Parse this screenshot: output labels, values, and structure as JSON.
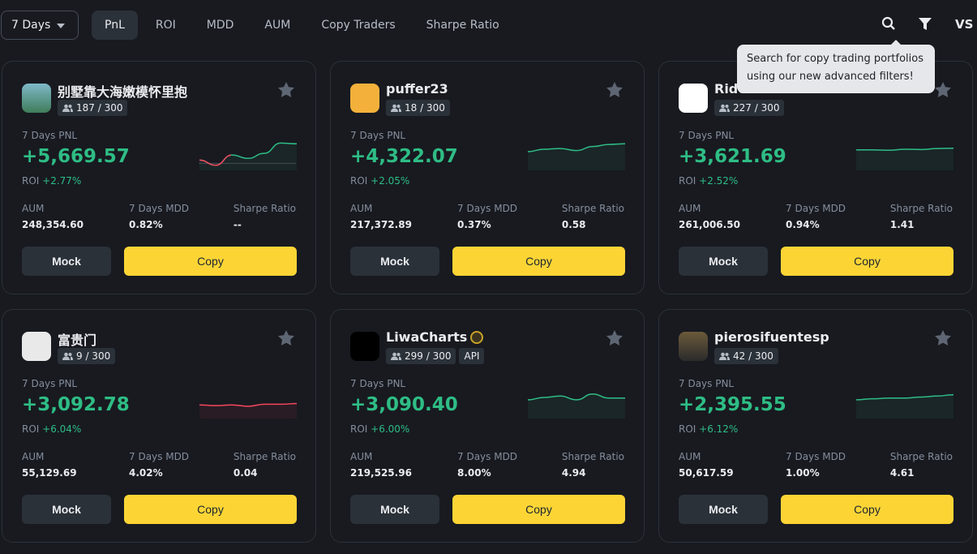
{
  "filter": {
    "period": "7 Days"
  },
  "tabs": [
    "PnL",
    "ROI",
    "MDD",
    "AUM",
    "Copy Traders",
    "Sharpe Ratio"
  ],
  "active_tab": "PnL",
  "vs_label": "VS",
  "tooltip": "Search for copy trading portfolios using our new advanced filters!",
  "colors": {
    "accent": "#fcd535",
    "positive": "#2ebd85",
    "negative": "#f6465d"
  },
  "labels": {
    "pnl": "7 Days PNL",
    "roi": "ROI",
    "aum": "AUM",
    "mdd": "7 Days MDD",
    "sharpe": "Sharpe Ratio",
    "mock": "Mock",
    "copy": "Copy"
  },
  "cards": [
    {
      "name": "别墅靠大海嫩模怀里抱",
      "copiers": "187 / 300",
      "pnl": "+5,669.57",
      "roi": "+2.77%",
      "aum": "248,354.60",
      "mdd": "0.82%",
      "sharpe": "--",
      "trend": [
        0.3,
        0.15,
        0.45,
        0.35,
        0.5,
        0.8,
        0.78
      ],
      "trend_color": "mixed"
    },
    {
      "name": "puffer23",
      "copiers": "18 / 300",
      "pnl": "+4,322.07",
      "roi": "+2.05%",
      "aum": "217,372.89",
      "mdd": "0.37%",
      "sharpe": "0.58",
      "trend": [
        0.55,
        0.62,
        0.64,
        0.58,
        0.7,
        0.76,
        0.78
      ],
      "trend_color": "positive"
    },
    {
      "name": "RideTheWave",
      "copiers": "227 / 300",
      "pnl": "+3,621.69",
      "roi": "+2.52%",
      "aum": "261,006.50",
      "mdd": "0.94%",
      "sharpe": "1.41",
      "trend": [
        0.6,
        0.6,
        0.59,
        0.62,
        0.61,
        0.64,
        0.65
      ],
      "trend_color": "positive"
    },
    {
      "name": "富贵门",
      "copiers": "9 / 300",
      "pnl": "+3,092.78",
      "roi": "+6.04%",
      "aum": "55,129.69",
      "mdd": "4.02%",
      "sharpe": "0.04",
      "trend": [
        0.4,
        0.38,
        0.4,
        0.36,
        0.42,
        0.42,
        0.44
      ],
      "trend_color": "negative"
    },
    {
      "name": "LiwaCharts",
      "copiers": "299 / 300",
      "api": "API",
      "pnl": "+3,090.40",
      "roi": "+6.00%",
      "aum": "219,525.96",
      "mdd": "8.00%",
      "sharpe": "4.94",
      "trend": [
        0.55,
        0.62,
        0.66,
        0.55,
        0.72,
        0.6,
        0.6
      ],
      "trend_color": "positive"
    },
    {
      "name": "pierosifuentesp",
      "copiers": "42 / 300",
      "pnl": "+2,395.55",
      "roi": "+6.12%",
      "aum": "50,617.59",
      "mdd": "1.00%",
      "sharpe": "4.61",
      "trend": [
        0.55,
        0.58,
        0.6,
        0.6,
        0.63,
        0.66,
        0.7
      ],
      "trend_color": "positive"
    }
  ]
}
